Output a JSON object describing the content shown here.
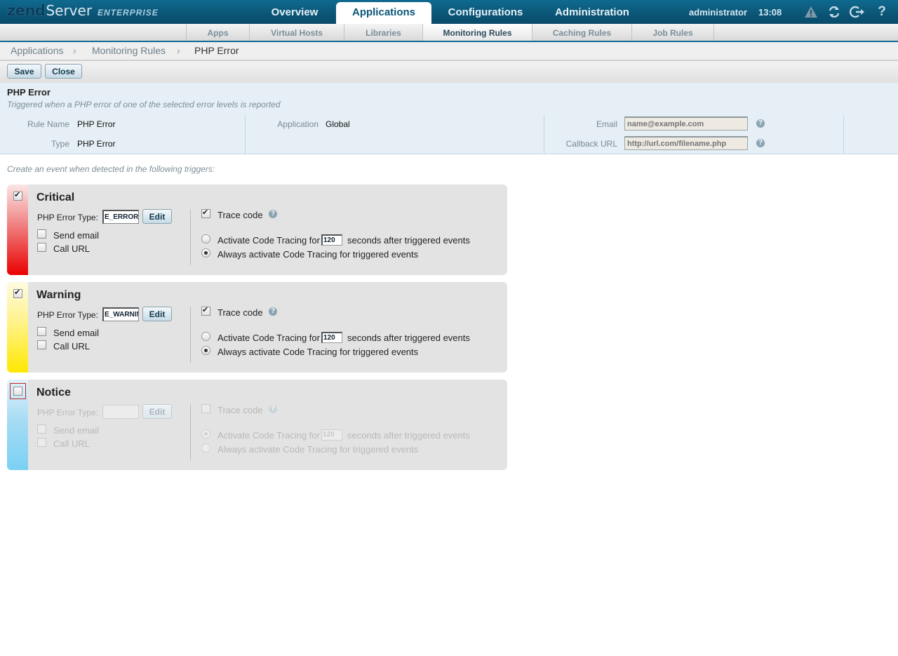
{
  "header": {
    "logo_zend": "zend",
    "logo_server": "Server",
    "logo_edition": "ENTERPRISE",
    "main_tabs": [
      {
        "label": "Overview",
        "active": false
      },
      {
        "label": "Applications",
        "active": true
      },
      {
        "label": "Configurations",
        "active": false
      },
      {
        "label": "Administration",
        "active": false
      }
    ],
    "user": "administrator",
    "time": "13:08",
    "icons": [
      "warning-icon",
      "refresh-icon",
      "logout-icon",
      "help-icon"
    ],
    "help_glyph": "?"
  },
  "sub_tabs": [
    {
      "label": "Apps",
      "active": false
    },
    {
      "label": "Virtual Hosts",
      "active": false
    },
    {
      "label": "Libraries",
      "active": false
    },
    {
      "label": "Monitoring Rules",
      "active": true
    },
    {
      "label": "Caching Rules",
      "active": false
    },
    {
      "label": "Job Rules",
      "active": false
    }
  ],
  "breadcrumb": [
    "Applications",
    "Monitoring Rules",
    "PHP Error"
  ],
  "breadcrumb_separator": "›",
  "toolbar": {
    "save": "Save",
    "close": "Close"
  },
  "rule": {
    "title": "PHP Error",
    "description": "Triggered when a PHP error of one of the selected error levels is reported",
    "rule_name_label": "Rule Name",
    "rule_name": "PHP Error",
    "type_label": "Type",
    "type": "PHP Error",
    "application_label": "Application",
    "application": "Global",
    "email_label": "Email",
    "email_placeholder": "name@example.com",
    "callback_label": "Callback URL",
    "callback_placeholder": "http://url.com/filename.php"
  },
  "triggers_intro": "Create an event when detected in the following triggers:",
  "common": {
    "php_error_type_label": "PHP Error Type:",
    "edit": "Edit",
    "send_email": "Send email",
    "call_url": "Call URL",
    "trace_code": "Trace code",
    "activate_prefix": "Activate Code Tracing for",
    "activate_suffix": "seconds after triggered events",
    "always_activate": "Always activate Code Tracing for triggered events",
    "help_glyph": "?"
  },
  "triggers": [
    {
      "name": "Critical",
      "enabled": true,
      "error_type": "E_ERROR,",
      "send_email": false,
      "call_url": false,
      "trace_code": true,
      "seconds": "120",
      "mode": "always",
      "color": "#e90000"
    },
    {
      "name": "Warning",
      "enabled": true,
      "error_type": "E_WARNING",
      "send_email": false,
      "call_url": false,
      "trace_code": true,
      "seconds": "120",
      "mode": "always",
      "color": "#ffe800"
    },
    {
      "name": "Notice",
      "enabled": false,
      "error_type": "",
      "send_email": false,
      "call_url": false,
      "trace_code": false,
      "seconds": "120",
      "mode": "activate",
      "color": "#7bd0f4"
    }
  ],
  "colors": {
    "brand": "#0b5576",
    "accent": "#0f6a8f",
    "panel": "#e3e3e3",
    "info_bg": "#e5eff5"
  }
}
